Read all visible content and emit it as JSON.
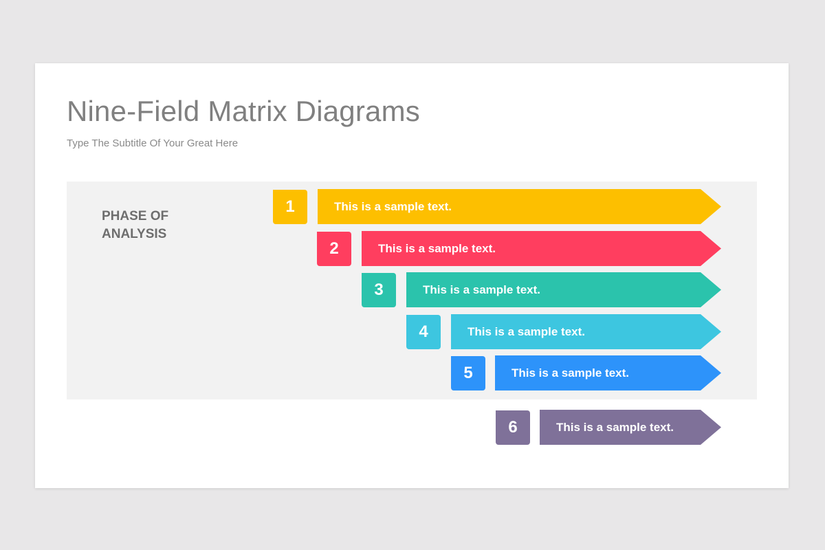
{
  "slide": {
    "title": "Nine-Field Matrix Diagrams",
    "subtitle": "Type The Subtitle Of Your Great Here",
    "panel_label": "PHASE OF\nANALYSIS"
  },
  "steps": [
    {
      "number": "1",
      "text": "This is a sample text.",
      "color": "#FDBF00"
    },
    {
      "number": "2",
      "text": "This is a sample text.",
      "color": "#FF3E5F"
    },
    {
      "number": "3",
      "text": "This is a sample text.",
      "color": "#2BC3AC"
    },
    {
      "number": "4",
      "text": "This is a sample text.",
      "color": "#3DC6E0"
    },
    {
      "number": "5",
      "text": "This is a sample text.",
      "color": "#2D93FA"
    },
    {
      "number": "6",
      "text": "This is a sample text.",
      "color": "#7F7199"
    }
  ]
}
